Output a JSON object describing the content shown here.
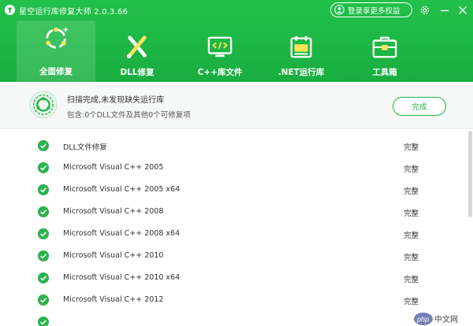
{
  "window": {
    "title": "星空运行库修复大师 2.0.3.66",
    "login_label": "登录享更多权益"
  },
  "tabs": [
    {
      "label": "全面修复",
      "icon": "repair-icon",
      "active": true
    },
    {
      "label": "DLL修复",
      "icon": "dll-tool-icon",
      "active": false
    },
    {
      "label": "C++库文件",
      "icon": "code-monitor-icon",
      "active": false
    },
    {
      "label": ".NET运行库",
      "icon": "dotnet-calendar-icon",
      "active": false
    },
    {
      "label": "工具箱",
      "icon": "toolbox-icon",
      "active": false
    }
  ],
  "status": {
    "title": "扫描完成,未发现缺失运行库",
    "subtitle": "包含:0个DLL文件及其他0个可修复项",
    "done_label": "完成"
  },
  "items": [
    {
      "name": "DLL文件修复",
      "state": "完整"
    },
    {
      "name": "Microsoft Visual C++ 2005",
      "state": "完整"
    },
    {
      "name": "Microsoft Visual C++ 2005 x64",
      "state": "完整"
    },
    {
      "name": "Microsoft Visual C++ 2008",
      "state": "完整"
    },
    {
      "name": "Microsoft Visual C++ 2008 x64",
      "state": "完整"
    },
    {
      "name": "Microsoft Visual C++ 2010",
      "state": "完整"
    },
    {
      "name": "Microsoft Visual C++ 2010 x64",
      "state": "完整"
    },
    {
      "name": "Microsoft Visual C++ 2012",
      "state": "完整"
    }
  ],
  "watermark": "php中文网",
  "colors": {
    "header_green": "#1db645",
    "accent_green": "#21b04a",
    "check_green": "#2bb24c"
  }
}
